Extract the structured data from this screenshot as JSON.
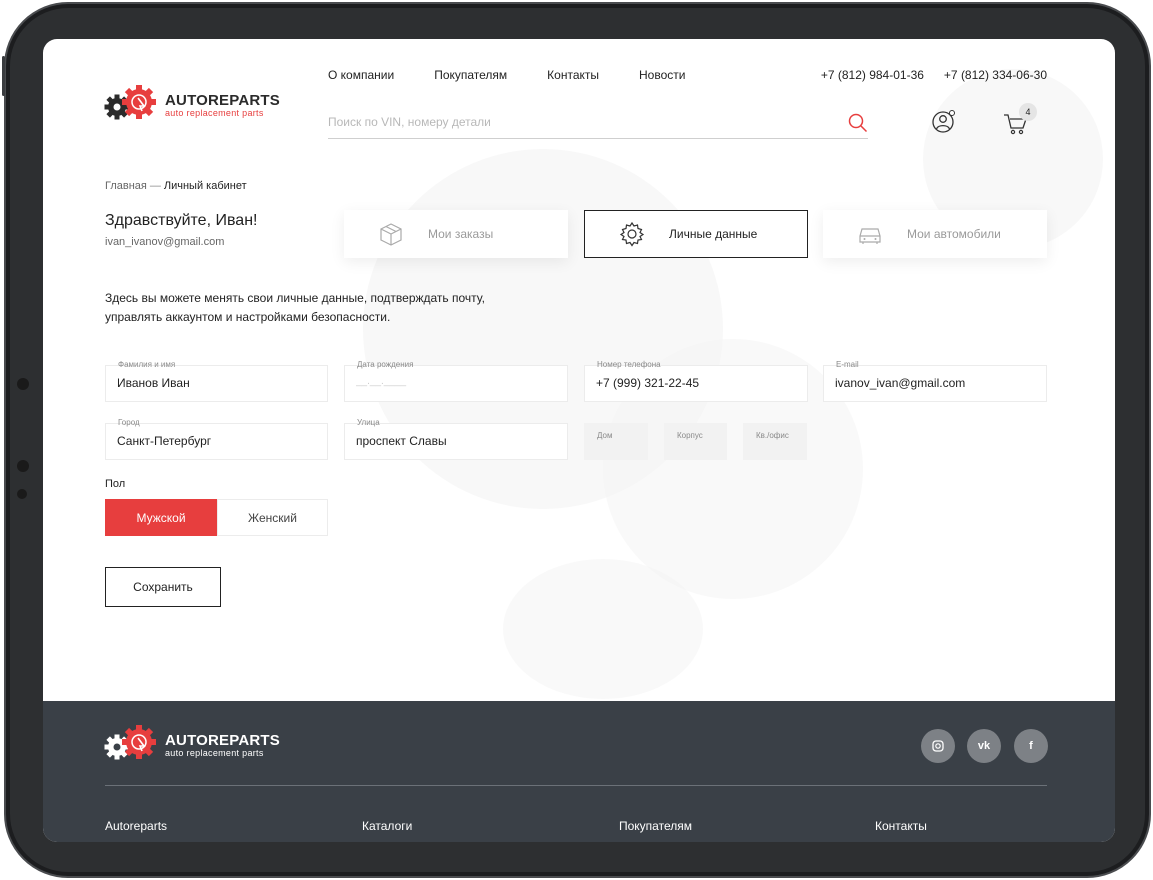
{
  "brand": {
    "name": "AUTOREPARTS",
    "tagline": "auto replacement parts",
    "accent": "#e73e3e"
  },
  "nav": {
    "items": [
      "О компании",
      "Покупателям",
      "Контакты",
      "Новости"
    ]
  },
  "phones": [
    "+7 (812) 984-01-36",
    "+7 (812) 334-06-30"
  ],
  "search": {
    "placeholder": "Поиск по VIN, номеру детали",
    "value": ""
  },
  "cart": {
    "count": "4"
  },
  "breadcrumb": {
    "home": "Главная",
    "separator": "—",
    "current": "Личный кабинет"
  },
  "account": {
    "greeting": "Здравствуйте, Иван!",
    "email": "ivan_ivanov@gmail.com"
  },
  "tabs": [
    {
      "label": "Мои заказы",
      "icon": "box-icon",
      "active": false
    },
    {
      "label": "Личные данные",
      "icon": "gear-icon",
      "active": true
    },
    {
      "label": "Мои автомобили",
      "icon": "car-icon",
      "active": false
    }
  ],
  "intro": "Здесь вы можете менять свои личные данные, подтверждать почту, управлять аккаунтом и настройками безопасности.",
  "form": {
    "name": {
      "label": "Фамилия и имя",
      "value": "Иванов Иван"
    },
    "birth": {
      "label": "Дата рождения",
      "value": "__.__.____"
    },
    "phone": {
      "label": "Номер телефона",
      "value": "+7 (999) 321-22-45"
    },
    "email": {
      "label": "E-mail",
      "value": "ivanov_ivan@gmail.com"
    },
    "city": {
      "label": "Город",
      "value": "Санкт-Петербург"
    },
    "street": {
      "label": "Улица",
      "value": "проспект Славы"
    },
    "house": {
      "label": "Дом",
      "value": ""
    },
    "building": {
      "label": "Корпус",
      "value": ""
    },
    "apartment": {
      "label": "Кв./офис",
      "value": ""
    },
    "gender_label": "Пол",
    "gender_male": "Мужской",
    "gender_female": "Женский",
    "selected_gender": "Мужской",
    "save_label": "Сохранить"
  },
  "footer": {
    "social": [
      "instagram-icon",
      "vk-icon",
      "facebook-icon"
    ],
    "vk_text": "vk",
    "fb_text": "f",
    "columns": [
      "Autoreparts",
      "Каталоги",
      "Покупателям",
      "Контакты"
    ]
  }
}
